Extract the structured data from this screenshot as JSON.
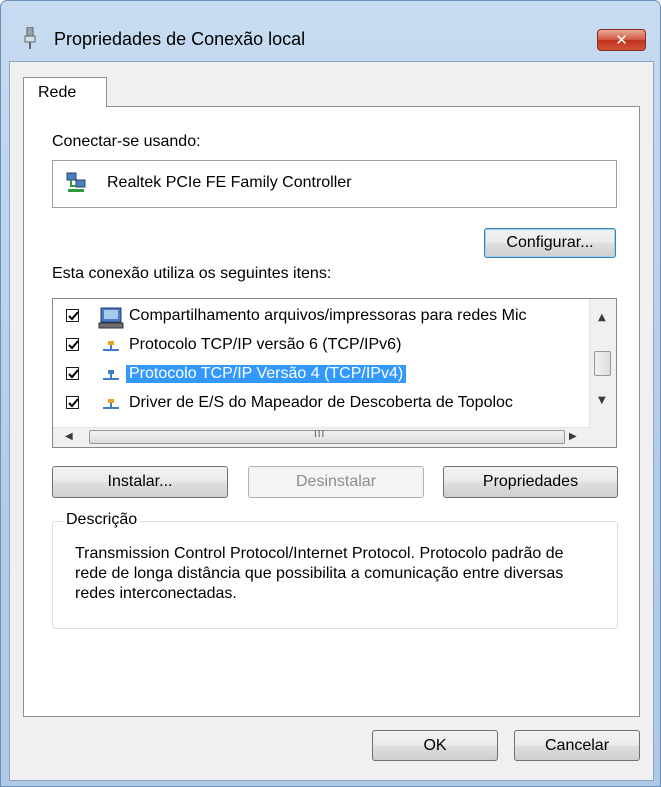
{
  "window": {
    "title": "Propriedades de Conexão local",
    "close_label": "✕"
  },
  "tabs": [
    {
      "label": "Rede"
    }
  ],
  "connect": {
    "label": "Conectar-se usando:",
    "adapter_name": "Realtek PCIe FE Family Controller",
    "configure_button": "Configurar..."
  },
  "items": {
    "label": "Esta conexão utiliza os seguintes itens:",
    "list": [
      {
        "text": "Compartilhamento arquivos/impressoras para redes Mic",
        "checked": true,
        "icon": "network-client-icon",
        "selected": false
      },
      {
        "text": "Protocolo TCP/IP versão 6 (TCP/IPv6)",
        "checked": true,
        "icon": "protocol-icon",
        "selected": false
      },
      {
        "text": "Protocolo TCP/IP Versão 4 (TCP/IPv4)",
        "checked": true,
        "icon": "protocol-icon",
        "selected": true
      },
      {
        "text": "Driver de E/S do Mapeador de Descoberta de Topoloc",
        "checked": true,
        "icon": "protocol-icon",
        "selected": false
      }
    ],
    "scroll_thumb_label": "III"
  },
  "buttons": {
    "install": "Instalar...",
    "uninstall": "Desinstalar",
    "properties": "Propriedades",
    "ok": "OK",
    "cancel": "Cancelar"
  },
  "description": {
    "legend": "Descrição",
    "text": "Transmission Control Protocol/Internet Protocol. Protocolo padrão de rede de longa distância que possibilita a comunicação entre diversas redes interconectadas."
  },
  "colors": {
    "selection": "#3399ff",
    "close_button": "#c7432b",
    "title_bar": "#b9d1ea"
  }
}
